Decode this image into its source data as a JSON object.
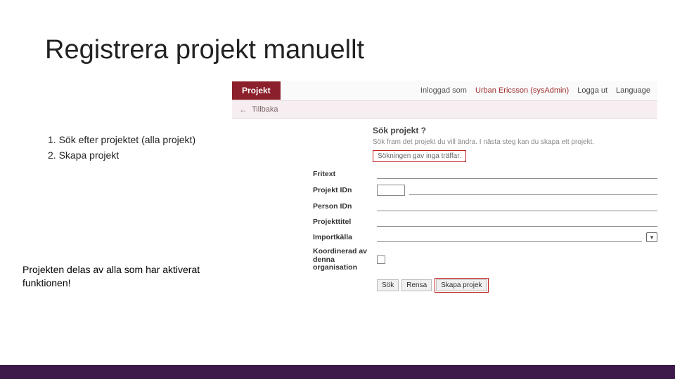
{
  "slide": {
    "title": "Registrera projekt manuellt",
    "steps": [
      "Sök efter projektet (alla projekt)",
      " Skapa projekt"
    ],
    "note": "Projekten delas av alla som har aktiverat funktionen!"
  },
  "app": {
    "tab_label": "Projekt",
    "logged_in_as_label": "Inloggad som",
    "user_name": "Urban Ericsson (sysAdmin)",
    "logout_label": "Logga ut",
    "language_label": "Language",
    "back_label": "Tillbaka",
    "search_section": {
      "title": "Sök projekt ?",
      "subtitle": "Sök fram det projekt du vill ändra. I nästa steg kan du skapa ett projekt.",
      "alert": "Sökningen gav inga träffar."
    },
    "fields": {
      "fritext": "Fritext",
      "projekt_idn": "Projekt IDn",
      "person_idn": "Person IDn",
      "projekttitel": "Projekttitel",
      "importkalla": "Importkälla",
      "koord": "Koordinerad av denna organisation"
    },
    "buttons": {
      "sok": "Sök",
      "rensa": "Rensa",
      "skapa": "Skapa projek"
    }
  }
}
